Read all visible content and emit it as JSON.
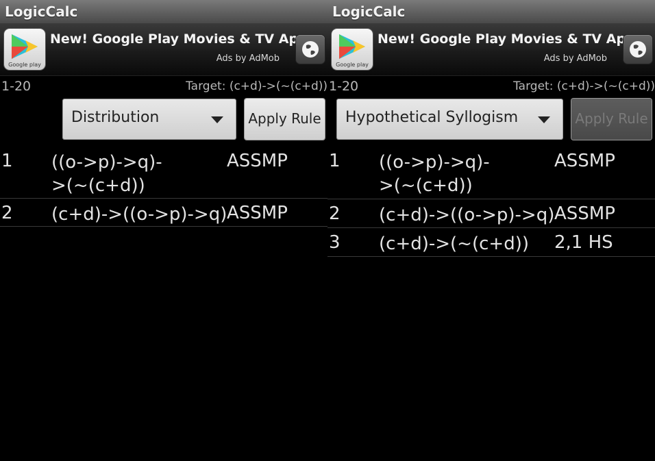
{
  "screens": [
    {
      "app_title": "LogicCalc",
      "ad": {
        "title": "New! Google Play Movies & TV App",
        "subtitle": "Ads by AdMob",
        "logo_text": "Google play"
      },
      "range": "1-20",
      "target": "Target: (c+d)->(~(c+d))",
      "rule_select": "Distribution",
      "apply_label": "Apply Rule",
      "apply_enabled": true,
      "rows": [
        {
          "num": "1",
          "expr": "((o->p)->q)->(~(c+d))",
          "just": "ASSMP"
        },
        {
          "num": "2",
          "expr": "(c+d)->((o->p)->q)",
          "just": "ASSMP"
        }
      ]
    },
    {
      "app_title": "LogicCalc",
      "ad": {
        "title": "New! Google Play Movies & TV App",
        "subtitle": "Ads by AdMob",
        "logo_text": "Google play"
      },
      "range": "1-20",
      "target": "Target: (c+d)->(~(c+d))",
      "rule_select": "Hypothetical Syllogism",
      "apply_label": "Apply Rule",
      "apply_enabled": false,
      "rows": [
        {
          "num": "1",
          "expr": "((o->p)->q)->(~(c+d))",
          "just": "ASSMP"
        },
        {
          "num": "2",
          "expr": "(c+d)->((o->p)->q)",
          "just": "ASSMP"
        },
        {
          "num": "3",
          "expr": "(c+d)->(~(c+d))",
          "just": "2,1 HS"
        }
      ]
    }
  ],
  "icons": {
    "ad_logo": "google-play-icon",
    "ad_button": "globe-icon"
  },
  "colors": {
    "background": "#000000",
    "titlebar": "#6b6b6b",
    "text": "#e3e3e3",
    "button": "#dcdcdc"
  }
}
